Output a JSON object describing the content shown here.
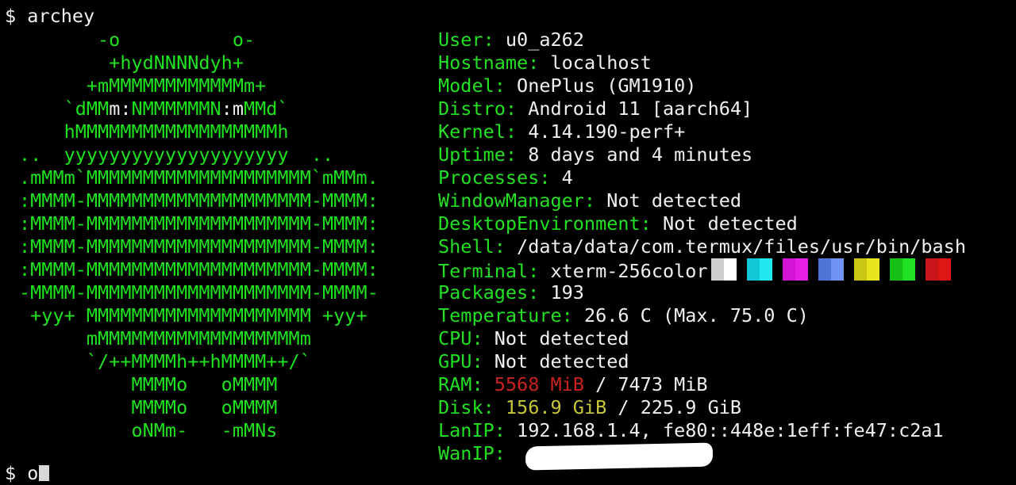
{
  "terminal": {
    "command_line": "$ archey",
    "prompt_line": "$ ",
    "prompt_typed": "o"
  },
  "logo": {
    "lines": [
      [
        [
          "g",
          "       -o          o-"
        ]
      ],
      [
        [
          "g",
          "        +hydNNNNdyh+"
        ]
      ],
      [
        [
          "g",
          "      +mMMMMMMMMMMMMm+"
        ]
      ],
      [
        [
          "g",
          "    `dMM"
        ],
        [
          "w",
          "m:"
        ],
        [
          "g",
          "NMMMMMMN"
        ],
        [
          "w",
          ":m"
        ],
        [
          "g",
          "MMd`"
        ]
      ],
      [
        [
          "g",
          "    hMMMMMMMMMMMMMMMMMMh"
        ]
      ],
      [
        [
          "g",
          "..  yyyyyyyyyyyyyyyyyyyy  .."
        ]
      ],
      [
        [
          "g",
          ".mMMm`MMMMMMMMMMMMMMMMMMMM`mMMm."
        ]
      ],
      [
        [
          "g",
          ":MMMM-MMMMMMMMMMMMMMMMMMMM-MMMM:"
        ]
      ],
      [
        [
          "g",
          ":MMMM-MMMMMMMMMMMMMMMMMMMM-MMMM:"
        ]
      ],
      [
        [
          "g",
          ":MMMM-MMMMMMMMMMMMMMMMMMMM-MMMM:"
        ]
      ],
      [
        [
          "g",
          ":MMMM-MMMMMMMMMMMMMMMMMMMM-MMMM:"
        ]
      ],
      [
        [
          "g",
          "-MMMM-MMMMMMMMMMMMMMMMMMMM-MMMM-"
        ]
      ],
      [
        [
          "g",
          " +yy+ MMMMMMMMMMMMMMMMMMMM +yy+"
        ]
      ],
      [
        [
          "g",
          "      mMMMMMMMMMMMMMMMMMMm"
        ]
      ],
      [
        [
          "g",
          "      `/++MMMMh++hMMMM++/`"
        ]
      ],
      [
        [
          "g",
          "          MMMMo   oMMMM"
        ]
      ],
      [
        [
          "g",
          "          MMMMo   oMMMM"
        ]
      ],
      [
        [
          "g",
          "          oNMm-   -mMNs"
        ]
      ]
    ]
  },
  "info": {
    "user": {
      "key": "User:",
      "value": "u0_a262"
    },
    "hostname": {
      "key": "Hostname:",
      "value": "localhost"
    },
    "model": {
      "key": "Model:",
      "value": "OnePlus (GM1910)"
    },
    "distro": {
      "key": "Distro:",
      "value": "Android 11 [aarch64]"
    },
    "kernel": {
      "key": "Kernel:",
      "value": "4.14.190-perf+"
    },
    "uptime": {
      "key": "Uptime:",
      "value": "8 days and 4 minutes"
    },
    "processes": {
      "key": "Processes:",
      "value": "4"
    },
    "window_manager": {
      "key": "WindowManager:",
      "value": "Not detected"
    },
    "desktop_environment": {
      "key": "DesktopEnvironment:",
      "value": "Not detected"
    },
    "shell": {
      "key": "Shell:",
      "value": "/data/data/com.termux/files/usr/bin/bash"
    },
    "terminal": {
      "key": "Terminal:",
      "value": "xterm-256color",
      "swatches": [
        {
          "dark": "#cfcfcf",
          "light": "#ffffff"
        },
        {
          "dark": "#13c8d6",
          "light": "#22e8f0"
        },
        {
          "dark": "#d414d4",
          "light": "#e61ee6"
        },
        {
          "dark": "#4f74d8",
          "light": "#6f94f4"
        },
        {
          "dark": "#c9c614",
          "light": "#e8e41f"
        },
        {
          "dark": "#16c016",
          "light": "#22e022"
        },
        {
          "dark": "#c8141a",
          "light": "#e01616"
        }
      ]
    },
    "packages": {
      "key": "Packages:",
      "value": "193"
    },
    "temperature": {
      "key": "Temperature:",
      "value": "26.6 C (Max. 75.0 C)"
    },
    "cpu": {
      "key": "CPU:",
      "value": "Not detected"
    },
    "gpu": {
      "key": "GPU:",
      "value": "Not detected"
    },
    "ram": {
      "key": "RAM:",
      "used": "5568 MiB",
      "sep": " / ",
      "total": "7473 MiB"
    },
    "disk": {
      "key": "Disk:",
      "used": "156.9 GiB",
      "sep": " / ",
      "total": "225.9 GiB"
    },
    "lan_ip": {
      "key": "LanIP:",
      "value": "192.168.1.4, fe80::448e:1eff:fe47:c2a1"
    },
    "wan_ip": {
      "key": "WanIP:",
      "value": ""
    }
  },
  "colors": {
    "logo_green": "#1fe21f",
    "key_green": "#22e022",
    "ram_used": "#c8221e",
    "disk_used": "#c8c63a",
    "background": "#000000"
  }
}
